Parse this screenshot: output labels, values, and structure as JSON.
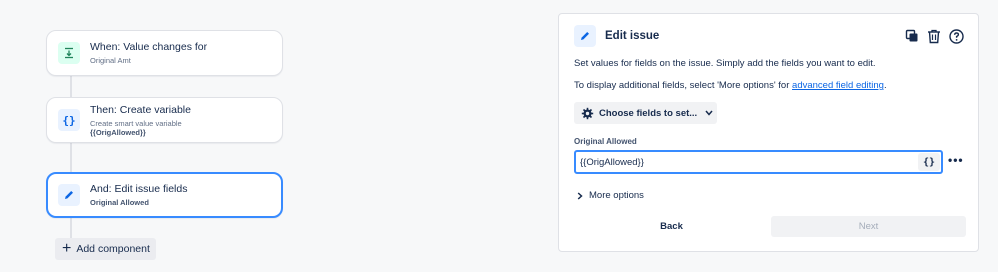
{
  "flow": {
    "trigger": {
      "title": "When: Value changes for",
      "subtitle": "Original Amt"
    },
    "variable": {
      "title": "Then: Create variable",
      "subtitle": "Create smart value variable",
      "subtitle2": "{{OrigAllowed}}"
    },
    "edit": {
      "title": "And: Edit issue fields",
      "subtitle": "Original Allowed"
    },
    "add_component": "Add component"
  },
  "panel": {
    "title": "Edit issue",
    "desc1": "Set values for fields on the issue. Simply add the fields you want to edit.",
    "desc2_prefix": "To display additional fields, select 'More options' for ",
    "desc2_link": "advanced field editing",
    "desc2_suffix": ".",
    "choose_fields": "Choose fields to set...",
    "field_label": "Original Allowed",
    "field_value": "{{OrigAllowed}}",
    "smart_value_btn": "{}",
    "more_dots": "•••",
    "more_options": "More options",
    "back": "Back",
    "next": "Next",
    "icons": [
      "copy-icon",
      "trash-icon",
      "help-icon"
    ]
  },
  "colors": {
    "accent": "#388bff",
    "link": "#0c66e4",
    "trigger_bg": "#dcfff1",
    "action_bg": "#e9f2ff"
  }
}
